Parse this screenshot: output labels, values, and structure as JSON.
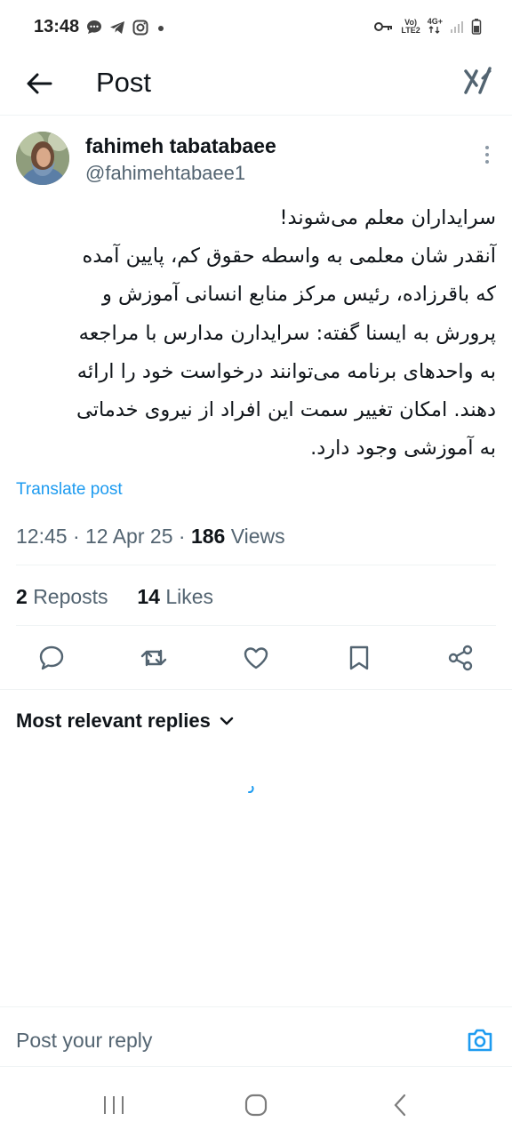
{
  "status_bar": {
    "time": "13:48",
    "network_top": "Vo)",
    "network_bottom": "LTE2",
    "signal_label": "4G+"
  },
  "header": {
    "title": "Post"
  },
  "author": {
    "name": "fahimeh tabatabaee",
    "handle": "@fahimehtabaee1"
  },
  "post": {
    "lines": [
      "سرایداران معلم می‌شوند!",
      "آنقدر شان معلمی به واسطه حقوق کم، پایین آمده",
      "که باقرزاده، رئیس مرکز منابع انسانی آموزش و",
      "پرورش به ایسنا گفته: سرایدارن مدارس با مراجعه",
      "به واحدهای برنامه می‌توانند درخواست خود را ارائه",
      "دهند. امکان تغییر سمت این افراد از نیروی خدماتی",
      "به آموزشی وجود دارد."
    ],
    "translate_label": "Translate post",
    "time": "12:45",
    "date": "12 Apr 25",
    "views_count": "186",
    "views_label": "Views",
    "reposts_count": "2",
    "reposts_label": "Reposts",
    "likes_count": "14",
    "likes_label": "Likes"
  },
  "replies": {
    "sort_label": "Most relevant replies"
  },
  "reply_bar": {
    "placeholder": "Post your reply"
  },
  "colors": {
    "accent": "#1d9bf0",
    "secondary_text": "#536471",
    "primary_text": "#0f1419"
  }
}
